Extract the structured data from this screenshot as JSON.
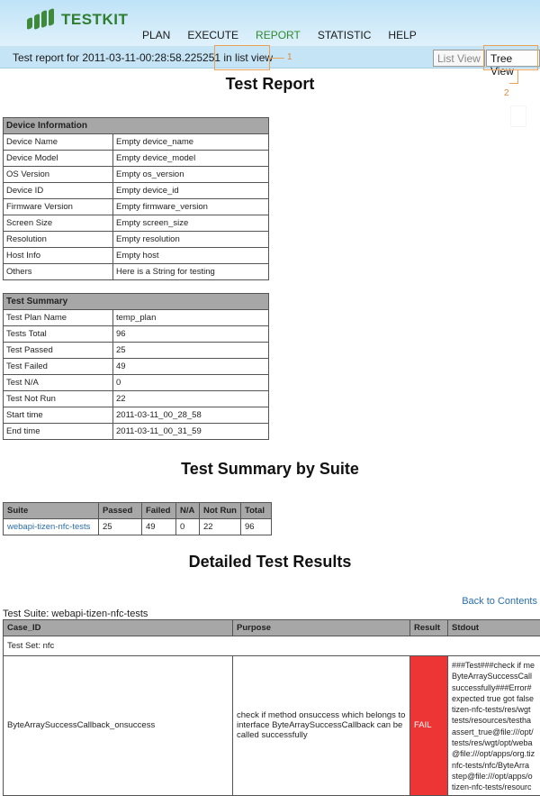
{
  "header": {
    "logo_text": "TESTKIT",
    "nav": [
      {
        "label": "PLAN"
      },
      {
        "label": "EXECUTE"
      },
      {
        "label": "REPORT"
      },
      {
        "label": "STATISTIC"
      },
      {
        "label": "HELP"
      }
    ],
    "active_nav": "REPORT",
    "colors": {
      "accent": "#2e8b2e",
      "bar": "#c5e4f6",
      "annotation": "#e8a25a"
    }
  },
  "subbar": {
    "report_title": "Test report for 2011-03-11-00:28:58.225251 in list view",
    "list_view_button": "List View",
    "tree_view_button": "Tree View",
    "annotation_1": "1",
    "annotation_2": "2"
  },
  "page_title": "Test Report",
  "device_info": {
    "header": "Device Information",
    "rows": [
      {
        "key": "Device Name",
        "value": "Empty device_name"
      },
      {
        "key": "Device Model",
        "value": "Empty device_model"
      },
      {
        "key": "OS Version",
        "value": "Empty os_version"
      },
      {
        "key": "Device ID",
        "value": "Empty device_id"
      },
      {
        "key": "Firmware Version",
        "value": "Empty firmware_version"
      },
      {
        "key": "Screen Size",
        "value": "Empty screen_size"
      },
      {
        "key": "Resolution",
        "value": "Empty resolution"
      },
      {
        "key": "Host Info",
        "value": "Empty host"
      },
      {
        "key": "Others",
        "value": "Here is a String for testing"
      }
    ]
  },
  "test_summary": {
    "header": "Test Summary",
    "rows": [
      {
        "key": "Test Plan Name",
        "value": "temp_plan"
      },
      {
        "key": "Tests Total",
        "value": "96"
      },
      {
        "key": "Test Passed",
        "value": "25"
      },
      {
        "key": "Test Failed",
        "value": "49"
      },
      {
        "key": "Test N/A",
        "value": "0"
      },
      {
        "key": "Test Not Run",
        "value": "22"
      },
      {
        "key": "Start time",
        "value": "2011-03-11_00_28_58"
      },
      {
        "key": "End time",
        "value": "2011-03-11_00_31_59"
      }
    ]
  },
  "suite_summary": {
    "title": "Test Summary by Suite",
    "columns": [
      "Suite",
      "Passed",
      "Failed",
      "N/A",
      "Not Run",
      "Total"
    ],
    "rows": [
      {
        "suite": "webapi-tizen-nfc-tests",
        "passed": "25",
        "failed": "49",
        "na": "0",
        "not_run": "22",
        "total": "96"
      }
    ]
  },
  "detailed": {
    "title": "Detailed Test Results",
    "back_link": "Back to Contents",
    "suite_label": "Test Suite: webapi-tizen-nfc-tests",
    "columns": [
      "Case_ID",
      "Purpose",
      "Result",
      "Stdout"
    ],
    "test_set": "Test Set: nfc",
    "rows": [
      {
        "case_id": "ByteArraySuccessCallback_onsuccess",
        "purpose": "check if method onsuccess which belongs to interface ByteArraySuccessCallback can be called successfully",
        "result": "FAIL",
        "stdout": "###Test###check if me\nByteArraySuccessCall\nsuccessfully###Error#\nexpected true got false\ntizen-nfc-tests/res/wgt\ntests/resources/testha\nassert_true@file:///opt/\ntests/res/wgt/opt/weba\n@file:///opt/apps/org.tiz\nnfc-tests/nfc/ByteArra\nstep@file:///opt/apps/o\ntizen-nfc-tests/resourc"
      }
    ]
  }
}
